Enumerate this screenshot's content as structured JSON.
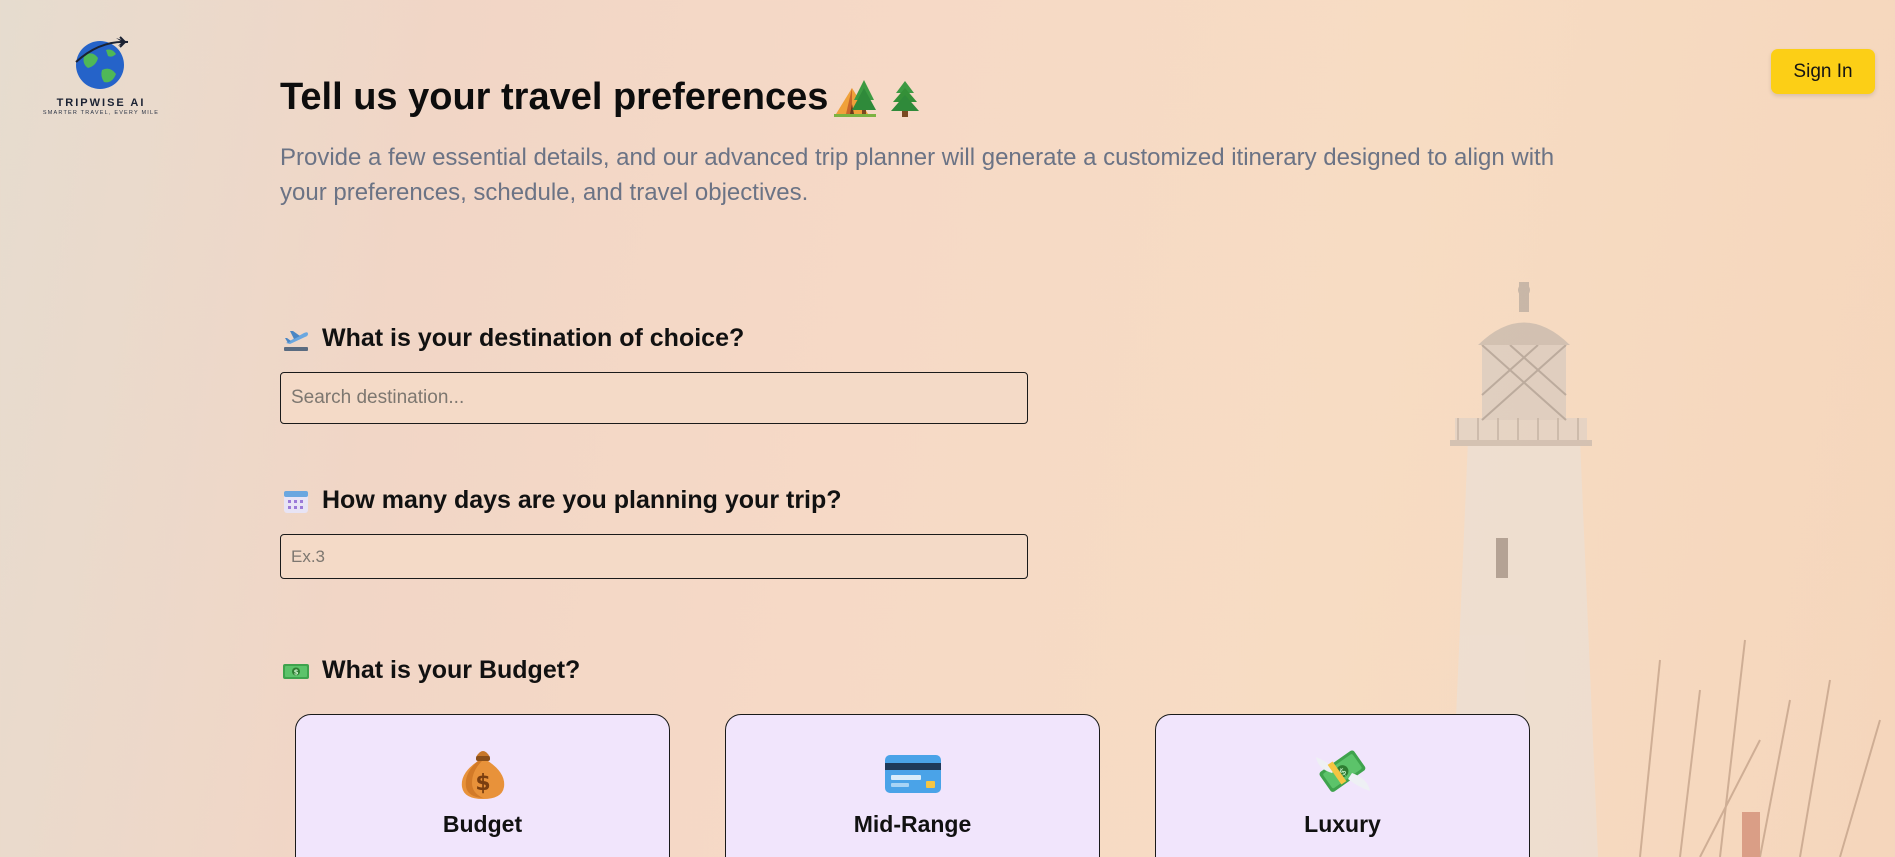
{
  "brand": {
    "name": "TRIPWISE AI",
    "tagline": "SMARTER TRAVEL, EVERY MILE"
  },
  "header": {
    "signin_label": "Sign In"
  },
  "main": {
    "title": "Tell us your travel preferences",
    "title_icons": [
      "camping-icon",
      "tree-icon"
    ],
    "subtitle": "Provide a few essential details, and our advanced trip planner will generate a customized itinerary designed to align with your preferences, schedule, and travel objectives."
  },
  "destination": {
    "label": "What is your destination of choice?",
    "icon": "airplane-departure-icon",
    "placeholder": "Search destination..."
  },
  "days": {
    "label": "How many days are you planning your trip?",
    "icon": "calendar-icon",
    "placeholder": "Ex.3"
  },
  "budget": {
    "label": "What is your Budget?",
    "icon": "money-icon",
    "options": [
      {
        "title": "Budget",
        "icon": "money-bag-icon"
      },
      {
        "title": "Mid-Range",
        "icon": "credit-card-icon"
      },
      {
        "title": "Luxury",
        "icon": "money-with-wings-icon"
      }
    ]
  },
  "colors": {
    "accent": "#fccf16",
    "card_bg": "#f1e5fc",
    "subtitle": "#6b7385"
  }
}
